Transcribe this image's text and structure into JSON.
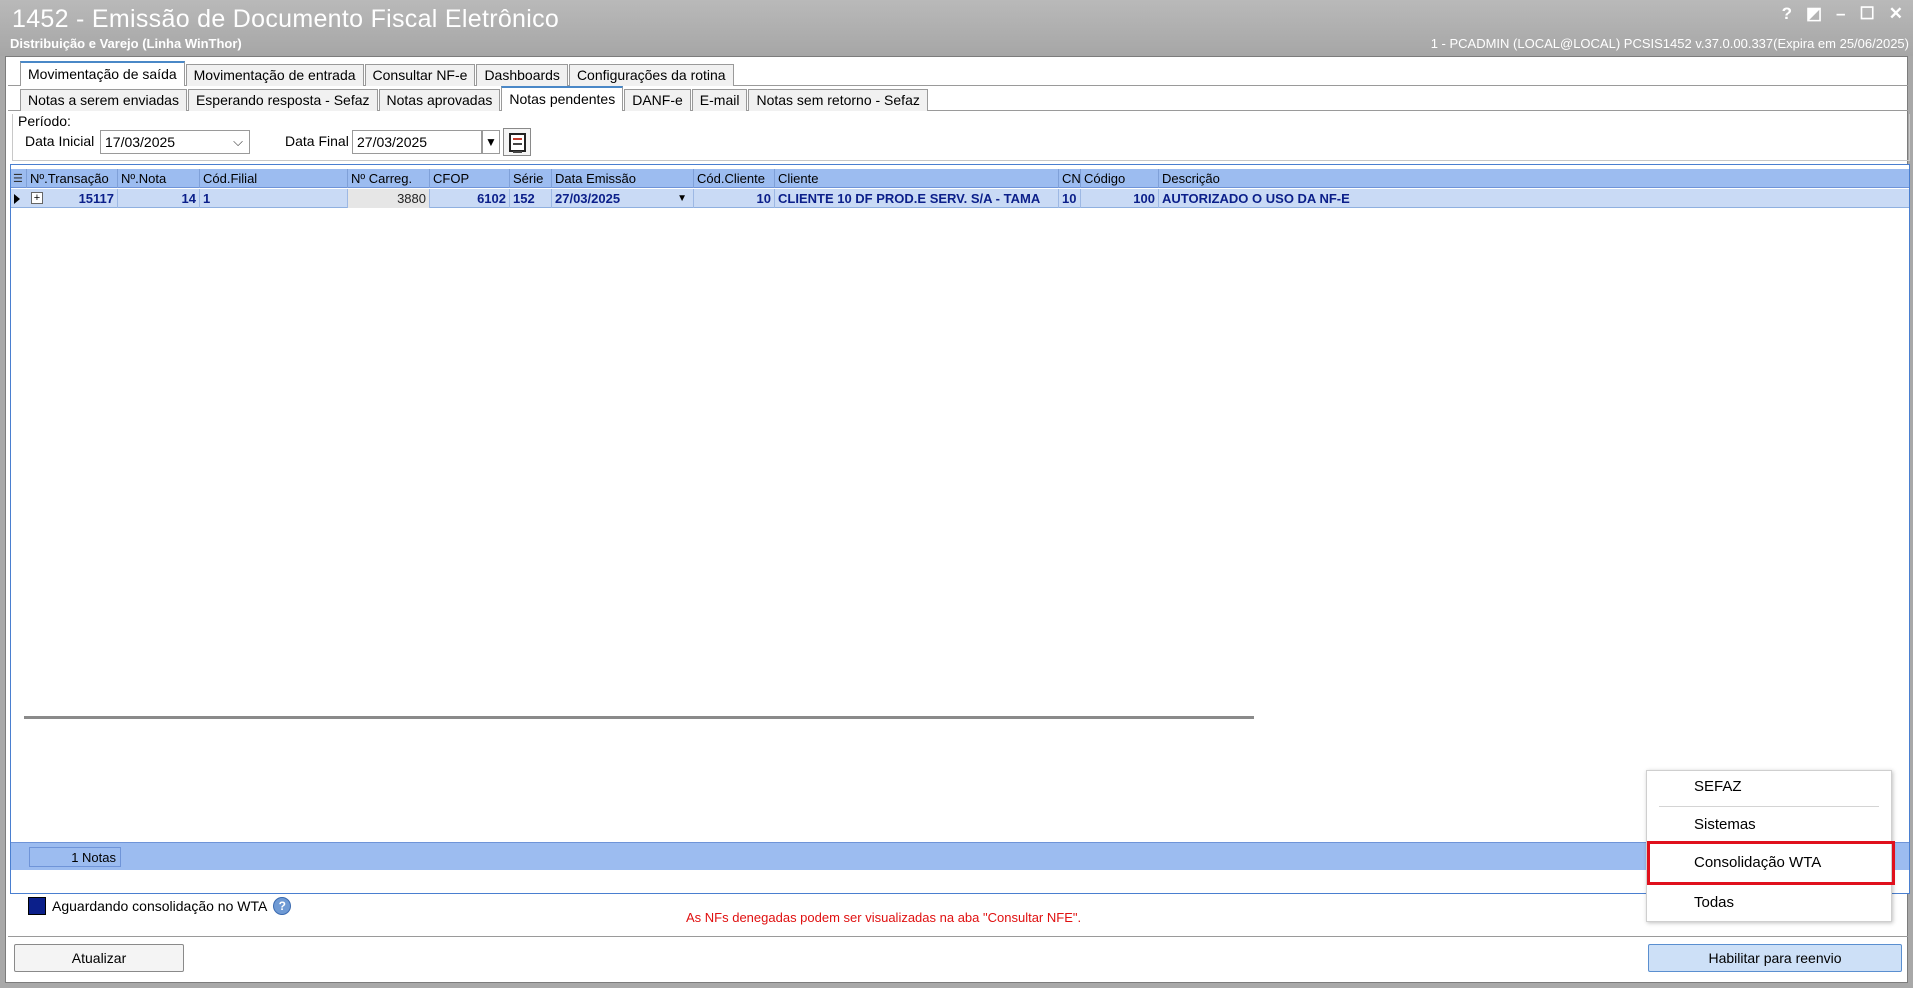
{
  "window": {
    "title": "1452 - Emissão de Documento Fiscal Eletrônico",
    "subtitle": "Distribuição e Varejo (Linha WinThor)",
    "session_info": "1 - PCADMIN (LOCAL@LOCAL)   PCSIS1452  v.37.0.00.337(Expira em 25/06/2025)",
    "controls": [
      "?",
      "◩",
      "–",
      "☐",
      "✕"
    ]
  },
  "main_tabs": [
    {
      "label": "Movimentação de saída",
      "active": true
    },
    {
      "label": "Movimentação de entrada",
      "active": false
    },
    {
      "label": "Consultar NF-e",
      "active": false
    },
    {
      "label": "Dashboards",
      "active": false
    },
    {
      "label": "Configurações da rotina",
      "active": false
    }
  ],
  "sub_tabs": [
    {
      "label": "Notas a serem enviadas",
      "active": false
    },
    {
      "label": "Esperando resposta - Sefaz",
      "active": false
    },
    {
      "label": "Notas aprovadas",
      "active": false
    },
    {
      "label": "Notas pendentes",
      "active": true
    },
    {
      "label": "DANF-e",
      "active": false
    },
    {
      "label": "E-mail",
      "active": false
    },
    {
      "label": "Notas sem retorno - Sefaz",
      "active": false
    }
  ],
  "periodo": {
    "label": "Período:",
    "data_inicial_label": "Data Inicial",
    "data_inicial": "17/03/2025",
    "data_final_label": "Data Final",
    "data_final": "27/03/2025"
  },
  "grid": {
    "columns": [
      "Nº.Transação",
      "Nº.Nota",
      "Cód.Filial",
      "Nº Carreg.",
      "CFOP",
      "Série",
      "Data Emissão",
      "Cód.Cliente",
      "Cliente",
      "CN",
      "Código",
      "Descrição"
    ],
    "sort_arrow": "▲",
    "rows": [
      {
        "transacao": "15117",
        "nota": "14",
        "filial": "1",
        "carreg": "3880",
        "cfop": "6102",
        "serie": "152",
        "emissao": "27/03/2025",
        "cod_cliente": "10",
        "cliente": "CLIENTE 10 DF PROD.E  SERV. S/A -  TAMA",
        "cn": "10",
        "codigo": "100",
        "descricao": "AUTORIZADO O USO DA NF-E"
      }
    ],
    "footer_count": "1 Notas"
  },
  "legend": {
    "label": "Aguardando consolidação no WTA",
    "color": "#0b1f8a"
  },
  "notice": "As NFs denegadas podem ser visualizadas na aba \"Consultar NFE\".",
  "buttons": {
    "atualizar": "Atualizar",
    "habilitar": "Habilitar para reenvio"
  },
  "context_menu": {
    "items": [
      "SEFAZ",
      "Sistemas",
      "Consolidação WTA",
      "Todas"
    ],
    "highlighted": "Consolidação WTA",
    "highlight_color": "#e0101c"
  }
}
